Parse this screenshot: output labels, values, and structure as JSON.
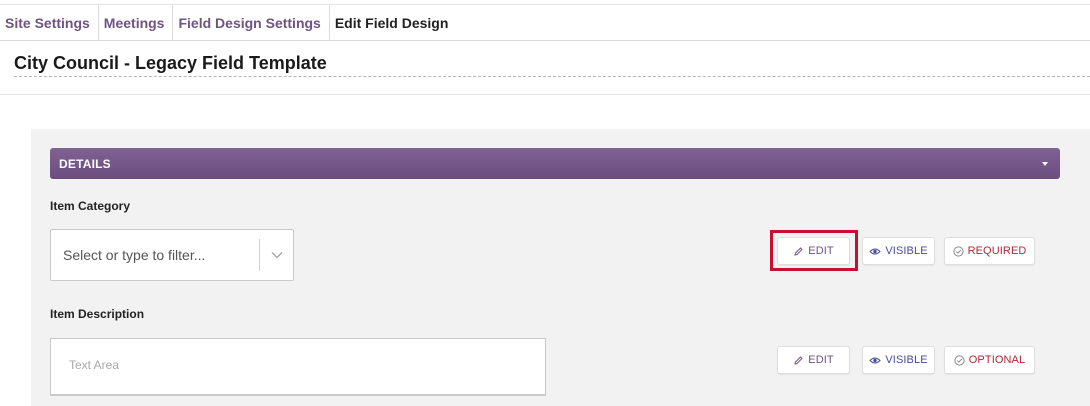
{
  "breadcrumb": {
    "items": [
      {
        "label": "Site Settings"
      },
      {
        "label": "Meetings"
      },
      {
        "label": "Field Design Settings"
      },
      {
        "label": "Edit Field Design"
      }
    ]
  },
  "page": {
    "title": "City Council - Legacy Field Template"
  },
  "section": {
    "title": "DETAILS"
  },
  "fields": [
    {
      "label": "Item Category",
      "placeholder": "Select or type to filter...",
      "buttons": {
        "edit": "EDIT",
        "visible": "VISIBLE",
        "requirement": "REQUIRED"
      }
    },
    {
      "label": "Item Description",
      "placeholder": "Text Area",
      "buttons": {
        "edit": "EDIT",
        "visible": "VISIBLE",
        "requirement": "OPTIONAL"
      }
    }
  ],
  "icons": {
    "edit": "pencil-icon",
    "visible": "eye-icon",
    "requirement": "check-circle-icon",
    "select_arrow": "chevron-down-icon",
    "section_toggle": "caret-down-icon"
  },
  "colors": {
    "accent": "#6f5383",
    "section_header": "#735587",
    "visible": "#4a4a9a",
    "required": "#b3253a",
    "highlight": "#c8102e"
  }
}
